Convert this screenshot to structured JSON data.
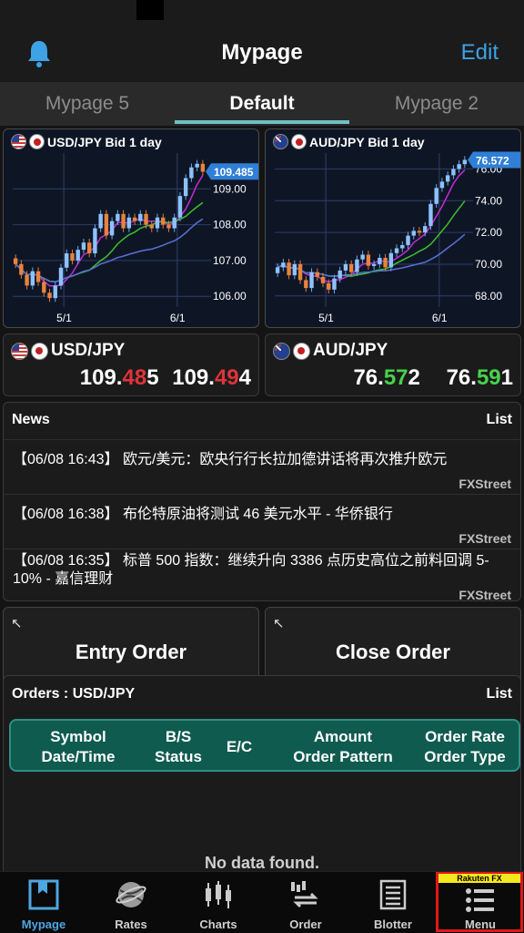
{
  "header": {
    "title": "Mypage",
    "edit_label": "Edit"
  },
  "tabs": [
    {
      "label": "Mypage 5"
    },
    {
      "label": "Default",
      "active": true
    },
    {
      "label": "Mypage 2"
    }
  ],
  "charts": [
    {
      "title": "USD/JPY Bid 1 day",
      "price_tag": "109.485",
      "y_ticks": [
        "109.00",
        "108.00",
        "107.00",
        "106.00"
      ],
      "x_ticks": [
        "5/1",
        "6/1"
      ]
    },
    {
      "title": "AUD/JPY Bid 1 day",
      "price_tag": "76.572",
      "y_ticks": [
        "76.00",
        "74.00",
        "72.00",
        "70.00",
        "68.00"
      ],
      "x_ticks": [
        "5/1",
        "6/1"
      ]
    }
  ],
  "chart_data": [
    {
      "type": "candlestick",
      "title": "USD/JPY Bid 1 day",
      "ylim": [
        105.7,
        110.0
      ],
      "x_ticks": [
        "5/1",
        "6/1"
      ],
      "last_price": 109.485,
      "closes": [
        106.9,
        106.6,
        106.3,
        106.7,
        106.4,
        106.1,
        105.95,
        106.3,
        106.8,
        107.2,
        107.0,
        107.3,
        107.5,
        107.2,
        107.9,
        108.3,
        107.7,
        108.1,
        108.3,
        107.9,
        108.2,
        108.1,
        108.3,
        108.0,
        107.9,
        108.2,
        108.0,
        107.9,
        108.2,
        108.8,
        109.3,
        109.6,
        109.7,
        109.48
      ]
    },
    {
      "type": "candlestick",
      "title": "AUD/JPY Bid 1 day",
      "ylim": [
        67.3,
        77.0
      ],
      "x_ticks": [
        "5/1",
        "6/1"
      ],
      "last_price": 76.572,
      "closes": [
        69.8,
        70.1,
        69.3,
        70.0,
        69.0,
        68.5,
        69.5,
        69.2,
        68.8,
        68.4,
        69.1,
        69.6,
        70.0,
        69.5,
        70.3,
        70.6,
        69.9,
        70.0,
        70.4,
        69.8,
        70.7,
        71.0,
        71.2,
        71.8,
        72.1,
        72.0,
        72.4,
        73.8,
        74.8,
        75.2,
        75.6,
        76.0,
        76.3,
        76.57
      ]
    }
  ],
  "quotes": [
    {
      "pair": "USD/JPY",
      "bid": {
        "pre": "109.",
        "big": "48",
        "post": "5"
      },
      "ask": {
        "pre": "109.",
        "big": "49",
        "post": "4"
      },
      "color": "red"
    },
    {
      "pair": "AUD/JPY",
      "bid": {
        "pre": "76.",
        "big": "57",
        "post": "2"
      },
      "ask": {
        "pre": "76.",
        "big": "59",
        "post": "1"
      },
      "color": "green"
    }
  ],
  "news": {
    "title": "News",
    "list_label": "List",
    "items": [
      {
        "text": "【06/08 16:43】 欧元/美元：欧央行行长拉加德讲话将再次推升欧元",
        "source": "FXStreet"
      },
      {
        "text": "【06/08 16:38】 布伦特原油将测试 46 美元水平 - 华侨银行",
        "source": "FXStreet"
      },
      {
        "text": "【06/08 16:35】 标普 500 指数：继续升向 3386 点历史高位之前料回调 5-10% -  嘉信理财",
        "source": "FXStreet"
      }
    ]
  },
  "actions": {
    "entry_order": "Entry Order",
    "close_order": "Close Order"
  },
  "orders": {
    "title": "Orders : USD/JPY",
    "list_label": "List",
    "columns": [
      {
        "line1": "Symbol",
        "line2": "Date/Time"
      },
      {
        "line1": "B/S",
        "line2": "Status"
      },
      {
        "line1": "E/C",
        "line2": ""
      },
      {
        "line1": "Amount",
        "line2": "Order Pattern"
      },
      {
        "line1": "Order Rate",
        "line2": "Order Type"
      }
    ],
    "empty_text": "No data found."
  },
  "bottom_nav": [
    {
      "label": "Mypage",
      "icon": "mypage-icon",
      "active": true
    },
    {
      "label": "Rates",
      "icon": "globe-icon"
    },
    {
      "label": "Charts",
      "icon": "candlestick-icon"
    },
    {
      "label": "Order",
      "icon": "order-icon"
    },
    {
      "label": "Blotter",
      "icon": "blotter-icon"
    },
    {
      "label": "Menu",
      "icon": "menu-icon"
    }
  ],
  "brand_tag": "Rakuten FX",
  "colors": {
    "accent": "#3ea2e6",
    "tab_indicator": "#6ec1c2",
    "down": "#e0333a",
    "up": "#47d34a",
    "orders_header": "#0f5b4f",
    "highlight_frame": "#e01818"
  }
}
